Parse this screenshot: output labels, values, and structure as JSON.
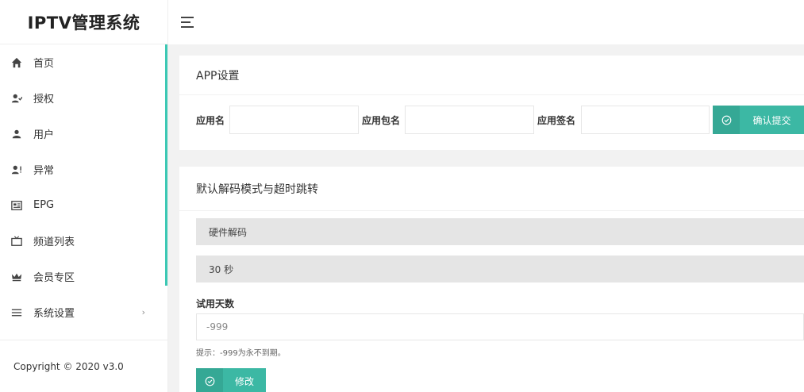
{
  "app": {
    "title": "IPTV管理系统"
  },
  "sidebar": {
    "items": [
      {
        "label": "首页",
        "icon": "home-icon"
      },
      {
        "label": "授权",
        "icon": "user-check-icon"
      },
      {
        "label": "用户",
        "icon": "user-icon"
      },
      {
        "label": "异常",
        "icon": "user-alert-icon"
      },
      {
        "label": "EPG",
        "icon": "epg-icon"
      },
      {
        "label": "频道列表",
        "icon": "tv-icon"
      },
      {
        "label": "会员专区",
        "icon": "crown-icon"
      },
      {
        "label": "系统设置",
        "icon": "menu-lines-icon",
        "arrow": "›"
      }
    ],
    "copyright": "Copyright © 2020 v3.0"
  },
  "app_settings": {
    "title": "APP设置",
    "app_name_label": "应用名",
    "app_name_value": "",
    "package_label": "应用包名",
    "package_value": "",
    "signature_label": "应用签名",
    "signature_value": "",
    "submit_label": "确认提交"
  },
  "decode_settings": {
    "title": "默认解码模式与超时跳转",
    "decode_mode": "硬件解码",
    "timeout": "30 秒",
    "trial_label": "试用天数",
    "trial_value": "-999",
    "hint": "提示：-999为永不到期。",
    "modify_label": "修改"
  },
  "colors": {
    "accent": "#3cb8a4",
    "active_bar": "#3cc8b4"
  }
}
